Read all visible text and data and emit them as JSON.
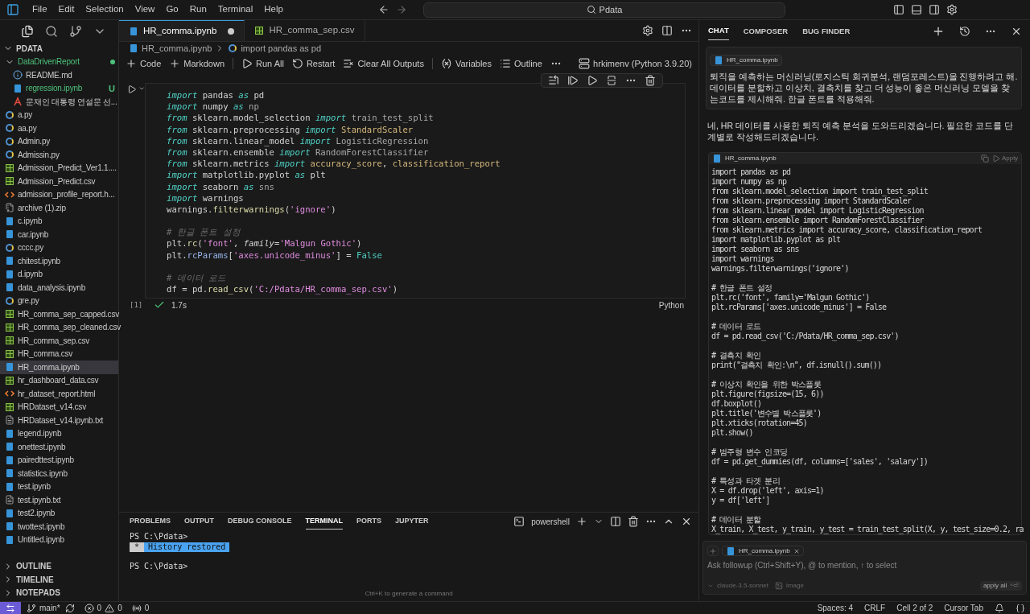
{
  "menu": [
    "File",
    "Edit",
    "Selection",
    "View",
    "Go",
    "Run",
    "Terminal",
    "Help"
  ],
  "title_search": "Pdata",
  "sidebar": {
    "root": "PDATA",
    "files": [
      {
        "name": "DataDrivenReport",
        "kind": "folder",
        "expanded": true,
        "color": "#4ec07a",
        "selected": false,
        "children": [
          {
            "name": "README.md",
            "kind": "md",
            "selected": false
          },
          {
            "name": "regression.ipynb",
            "kind": "ipynb",
            "color": "#4ec07a",
            "badge": "U",
            "selected": false
          },
          {
            "name": "문재인 대통령 연설문 선...",
            "kind": "pdf",
            "selected": false
          }
        ]
      },
      {
        "name": "a.py",
        "kind": "py",
        "selected": false
      },
      {
        "name": "aa.py",
        "kind": "py",
        "selected": false
      },
      {
        "name": "Admin.py",
        "kind": "py",
        "selected": false
      },
      {
        "name": "Admissin.py",
        "kind": "py",
        "selected": false
      },
      {
        "name": "Admission_Predict_Ver1.1....",
        "kind": "csv",
        "selected": false
      },
      {
        "name": "Admission_Predict.csv",
        "kind": "csv",
        "selected": false
      },
      {
        "name": "admission_profile_report.h...",
        "kind": "html",
        "selected": false
      },
      {
        "name": "archive (1).zip",
        "kind": "zip",
        "selected": false
      },
      {
        "name": "c.ipynb",
        "kind": "ipynb",
        "selected": false
      },
      {
        "name": "car.ipynb",
        "kind": "ipynb",
        "selected": false
      },
      {
        "name": "cccc.py",
        "kind": "py",
        "selected": false
      },
      {
        "name": "chitest.ipynb",
        "kind": "ipynb",
        "selected": false
      },
      {
        "name": "d.ipynb",
        "kind": "ipynb",
        "selected": false
      },
      {
        "name": "data_analysis.ipynb",
        "kind": "ipynb",
        "selected": false
      },
      {
        "name": "gre.py",
        "kind": "py",
        "selected": false
      },
      {
        "name": "HR_comma_sep_capped.csv",
        "kind": "csv",
        "selected": false
      },
      {
        "name": "HR_comma_sep_cleaned.csv",
        "kind": "csv",
        "selected": false
      },
      {
        "name": "HR_comma_sep.csv",
        "kind": "csv",
        "selected": false
      },
      {
        "name": "HR_comma.csv",
        "kind": "csv",
        "selected": false
      },
      {
        "name": "HR_comma.ipynb",
        "kind": "ipynb",
        "selected": true
      },
      {
        "name": "hr_dashboard_data.csv",
        "kind": "csv",
        "selected": false
      },
      {
        "name": "hr_dataset_report.html",
        "kind": "html",
        "selected": false
      },
      {
        "name": "HRDataset_v14.csv",
        "kind": "csv",
        "selected": false
      },
      {
        "name": "HRDataset_v14.ipynb.txt",
        "kind": "txt",
        "selected": false
      },
      {
        "name": "legend.ipynb",
        "kind": "ipynb",
        "selected": false
      },
      {
        "name": "onettest.ipynb",
        "kind": "ipynb",
        "selected": false
      },
      {
        "name": "pairedttest.ipynb",
        "kind": "ipynb",
        "selected": false
      },
      {
        "name": "statistics.ipynb",
        "kind": "ipynb",
        "selected": false
      },
      {
        "name": "test.ipynb",
        "kind": "ipynb",
        "selected": false
      },
      {
        "name": "test.ipynb.txt",
        "kind": "txt",
        "selected": false
      },
      {
        "name": "test2.ipynb",
        "kind": "ipynb",
        "selected": false
      },
      {
        "name": "twottest.ipynb",
        "kind": "ipynb",
        "selected": false
      },
      {
        "name": "Untitled.ipynb",
        "kind": "ipynb",
        "selected": false
      }
    ],
    "sections": [
      "OUTLINE",
      "TIMELINE",
      "NOTEPADS"
    ]
  },
  "editor_tabs": [
    {
      "label": "HR_comma.ipynb",
      "kind": "ipynb",
      "selected": true,
      "dirty": true
    },
    {
      "label": "HR_comma_sep.csv",
      "kind": "csv",
      "selected": false,
      "dirty": false
    }
  ],
  "breadcrumb": [
    "HR_comma.ipynb",
    "import pandas as pd"
  ],
  "toolbar": [
    {
      "label": "Code",
      "kind": "plus"
    },
    {
      "label": "Markdown",
      "kind": "plus"
    },
    {
      "label": "Run All",
      "kind": "run"
    },
    {
      "label": "Restart",
      "kind": "restart"
    },
    {
      "label": "Clear All Outputs",
      "kind": "clear"
    },
    {
      "label": "Variables",
      "kind": "variables"
    },
    {
      "label": "Outline",
      "kind": "outline"
    }
  ],
  "kernel": "hrkimenv (Python 3.9.20)",
  "cell": {
    "execution_count": "[1]",
    "success": true,
    "duration": "1.7s",
    "language": "Python",
    "blocks": [
      [
        [
          {
            "text": "import",
            "kind": "kw"
          },
          {
            "text": " pandas ",
            "kind": "id"
          },
          {
            "text": "as",
            "kind": "kw"
          },
          {
            "text": " pd",
            "kind": "id"
          }
        ],
        [
          {
            "text": "import",
            "kind": "kw"
          },
          {
            "text": " numpy ",
            "kind": "id"
          },
          {
            "text": "as",
            "kind": "kw"
          },
          {
            "text": " np",
            "kind": "dim"
          }
        ],
        [
          {
            "text": "from",
            "kind": "kw"
          },
          {
            "text": " sklearn.model_selection ",
            "kind": "id"
          },
          {
            "text": "import",
            "kind": "kw"
          },
          {
            "text": " train_test_split",
            "kind": "dim"
          }
        ],
        [
          {
            "text": "from",
            "kind": "kw"
          },
          {
            "text": " sklearn.preprocessing ",
            "kind": "id"
          },
          {
            "text": "import",
            "kind": "kw"
          },
          {
            "text": " StandardScaler",
            "kind": "cls"
          }
        ],
        [
          {
            "text": "from",
            "kind": "kw"
          },
          {
            "text": " sklearn.linear_model ",
            "kind": "id"
          },
          {
            "text": "import",
            "kind": "kw"
          },
          {
            "text": " LogisticRegression",
            "kind": "dim"
          }
        ],
        [
          {
            "text": "from",
            "kind": "kw"
          },
          {
            "text": " sklearn.ensemble ",
            "kind": "id"
          },
          {
            "text": "import",
            "kind": "kw"
          },
          {
            "text": " RandomForestClassifier",
            "kind": "dim"
          }
        ],
        [
          {
            "text": "from",
            "kind": "kw"
          },
          {
            "text": " sklearn.metrics ",
            "kind": "id"
          },
          {
            "text": "import",
            "kind": "kw"
          },
          {
            "text": " accuracy_score",
            "kind": "cls"
          },
          {
            "text": ", ",
            "kind": "id"
          },
          {
            "text": "classification_report",
            "kind": "cls"
          }
        ],
        [
          {
            "text": "import",
            "kind": "kw"
          },
          {
            "text": " matplotlib.pyplot ",
            "kind": "id"
          },
          {
            "text": "as",
            "kind": "kw"
          },
          {
            "text": " plt",
            "kind": "id"
          }
        ],
        [
          {
            "text": "import",
            "kind": "kw"
          },
          {
            "text": " seaborn ",
            "kind": "id"
          },
          {
            "text": "as",
            "kind": "kw"
          },
          {
            "text": " sns",
            "kind": "dim"
          }
        ],
        [
          {
            "text": "import",
            "kind": "kw"
          },
          {
            "text": " warnings",
            "kind": "id"
          }
        ],
        [
          {
            "text": "warnings.",
            "kind": "id"
          },
          {
            "text": "filterwarnings",
            "kind": "fn"
          },
          {
            "text": "(",
            "kind": "id"
          },
          {
            "text": "'ignore'",
            "kind": "str"
          },
          {
            "text": ")",
            "kind": "id"
          }
        ]
      ],
      [
        [
          {
            "text": "# 한글 폰트 설정",
            "kind": "com"
          }
        ],
        [
          {
            "text": "plt.",
            "kind": "id"
          },
          {
            "text": "rc",
            "kind": "fn"
          },
          {
            "text": "(",
            "kind": "id"
          },
          {
            "text": "'font'",
            "kind": "str"
          },
          {
            "text": ", ",
            "kind": "id"
          },
          {
            "text": "family",
            "kind": "param"
          },
          {
            "text": "=",
            "kind": "id"
          },
          {
            "text": "'Malgun Gothic'",
            "kind": "str"
          },
          {
            "text": ")",
            "kind": "id"
          }
        ],
        [
          {
            "text": "plt.",
            "kind": "id"
          },
          {
            "text": "rcParams",
            "kind": "attr"
          },
          {
            "text": "[",
            "kind": "id"
          },
          {
            "text": "'axes.unicode_minus'",
            "kind": "str"
          },
          {
            "text": "] = ",
            "kind": "id"
          },
          {
            "text": "False",
            "kind": "const"
          }
        ]
      ],
      [
        [
          {
            "text": "# 데이터 로드",
            "kind": "com"
          }
        ],
        [
          {
            "text": "df = pd.",
            "kind": "id"
          },
          {
            "text": "read_csv",
            "kind": "fn"
          },
          {
            "text": "(",
            "kind": "id"
          },
          {
            "text": "'C:/Pdata/HR_comma_sep.csv'",
            "kind": "str"
          },
          {
            "text": ")",
            "kind": "id"
          }
        ]
      ]
    ]
  },
  "panel": {
    "tabs": [
      {
        "label": "PROBLEMS",
        "selected": false
      },
      {
        "label": "OUTPUT",
        "selected": false
      },
      {
        "label": "DEBUG CONSOLE",
        "selected": false
      },
      {
        "label": "TERMINAL",
        "selected": true
      },
      {
        "label": "PORTS",
        "selected": false
      },
      {
        "label": "JUPYTER",
        "selected": false
      }
    ],
    "shell": "powershell",
    "prompt_1": "PS C:\\Pdata>",
    "history_mark": "*",
    "history_text": "History restored",
    "prompt_2": "PS C:\\Pdata>",
    "hint": "Ctrl+K to generate a command"
  },
  "chat": {
    "tabs": [
      {
        "label": "CHAT",
        "selected": true
      },
      {
        "label": "COMPOSER",
        "selected": false
      },
      {
        "label": "BUG FINDER",
        "selected": false
      }
    ],
    "user_file": "HR_comma.ipynb",
    "user_message": "퇴직을 예측하는 머신러닝(로지스틱 회귀분석, 랜덤포레스트)을 진행하려고 해. 데이터를 분할하고 이상치, 결측치를 찾고 더 성능이 좋은 머신러닝 모델을 찾는코드를 제시해줘. 한글 폰트를 적용해줘.",
    "reply": "네, HR 데이터를 사용한 퇴직 예측 분석을 도와드리겠습니다. 필요한 코드를 단계별로 작성해드리겠습니다.",
    "code_file": "HR_comma.ipynb",
    "apply": "Apply",
    "code_blocks": [
      [
        "import pandas as pd",
        "import numpy as np",
        "from sklearn.model_selection import train_test_split",
        "from sklearn.preprocessing import StandardScaler",
        "from sklearn.linear_model import LogisticRegression",
        "from sklearn.ensemble import RandomForestClassifier",
        "from sklearn.metrics import accuracy_score, classification_report",
        "import matplotlib.pyplot as plt",
        "import seaborn as sns",
        "import warnings",
        "warnings.filterwarnings('ignore')"
      ],
      [
        "# 한글 폰트 설정",
        "plt.rc('font', family='Malgun Gothic')",
        "plt.rcParams['axes.unicode_minus'] = False"
      ],
      [
        "# 데이터 로드",
        "df = pd.read_csv('C:/Pdata/HR_comma_sep.csv')"
      ],
      [
        "# 결측치 확인",
        "print(\"결측치 확인:\\n\", df.isnull().sum())"
      ],
      [
        "# 이상치 확인을 위한 박스플롯",
        "plt.figure(figsize=(15, 6))",
        "df.boxplot()",
        "plt.title('변수별 박스플롯')",
        "plt.xticks(rotation=45)",
        "plt.show()"
      ],
      [
        "# 범주형 변수 인코딩",
        "df = pd.get_dummies(df, columns=['sales', 'salary'])"
      ],
      [
        "# 특성과 타겟 분리",
        "X = df.drop('left', axis=1)",
        "y = df['left']"
      ],
      [
        "# 데이터 분할",
        "X_train, X_test, y_train, y_test = train_test_split(X, y, test_size=0.2, ra"
      ]
    ],
    "input_file": "HR_comma.ipynb",
    "placeholder": "Ask followup (Ctrl+Shift+Y), @ to mention, ↑ to select",
    "model": "claude-3.5-sonnet",
    "image_label": "image",
    "apply_all": "apply all",
    "apply_all_key": "^⏎"
  },
  "status_bar": {
    "branch": "main*",
    "errors": "0",
    "warnings": "0",
    "ports": "0",
    "right": [
      "Spaces: 4",
      "CRLF",
      "Cell 2 of 2",
      "Cursor Tab"
    ]
  }
}
